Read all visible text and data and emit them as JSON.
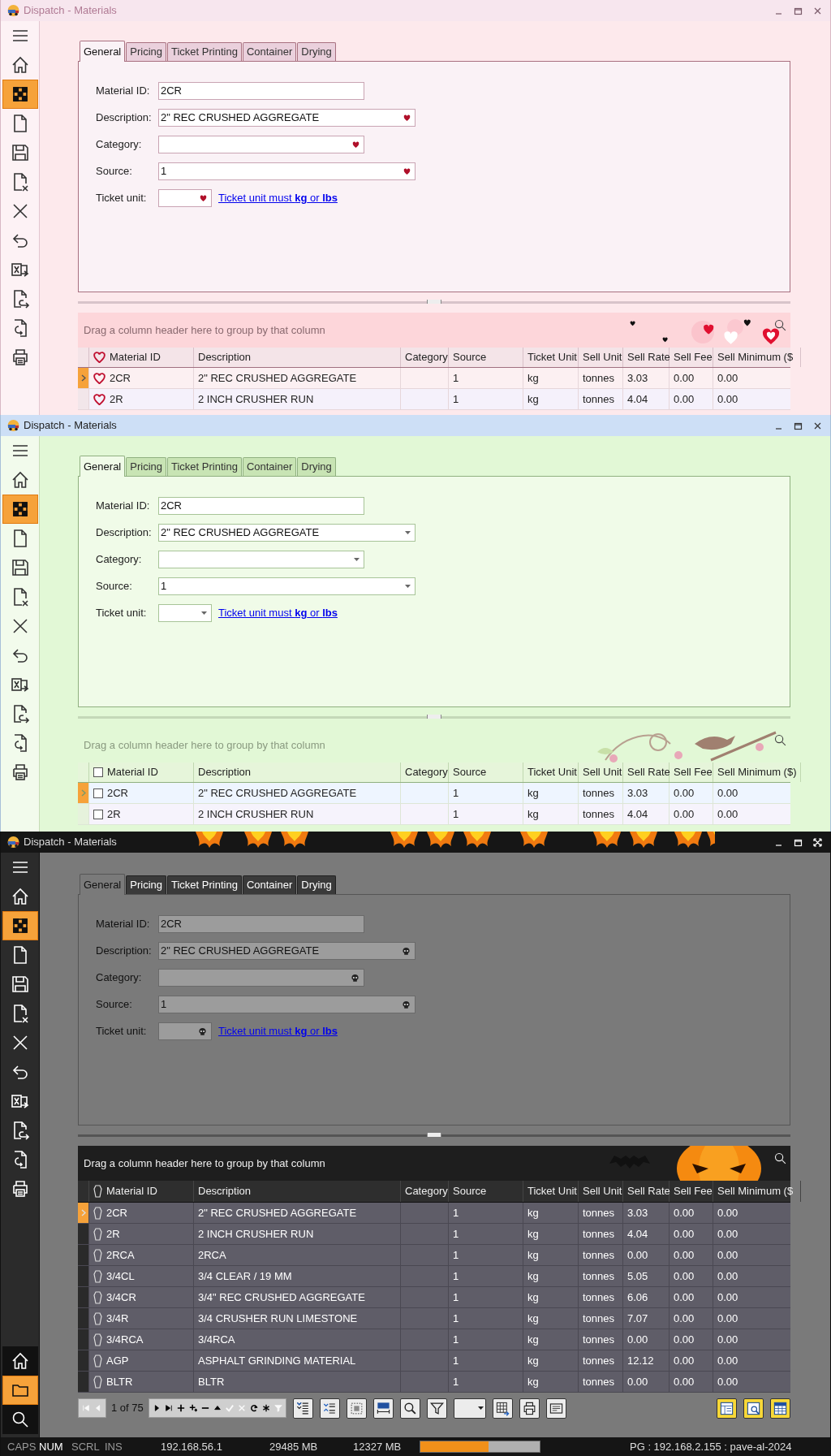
{
  "windows": [
    {
      "kind": "valentine",
      "title": "Dispatch - Materials",
      "title_buttons": [
        {
          "kind": "minimize"
        },
        {
          "kind": "maximize"
        },
        {
          "kind": "close"
        }
      ],
      "sidebar": [
        {
          "kind": "menu",
          "selected": false
        },
        {
          "kind": "home",
          "selected": false
        },
        {
          "kind": "grid",
          "selected": true
        },
        {
          "kind": "document",
          "selected": false
        },
        {
          "kind": "save",
          "selected": false
        },
        {
          "kind": "document-delete",
          "selected": false
        },
        {
          "kind": "close",
          "selected": false
        },
        {
          "kind": "undo",
          "selected": false
        },
        {
          "kind": "excel",
          "selected": false
        },
        {
          "kind": "document-import",
          "selected": false
        },
        {
          "kind": "document-export",
          "selected": false
        },
        {
          "kind": "print",
          "selected": false
        }
      ],
      "tabs": [
        {
          "label": "General",
          "selected": true
        },
        {
          "label": "Pricing",
          "selected": false
        },
        {
          "label": "Ticket Printing",
          "selected": false
        },
        {
          "label": "Container",
          "selected": false
        },
        {
          "label": "Drying",
          "selected": false
        }
      ],
      "form": [
        {
          "label": "Material ID:",
          "value": "2CR",
          "kind": "text"
        },
        {
          "label": "Description:",
          "value": "2\" REC CRUSHED AGGREGATE",
          "kind": "dropdown"
        },
        {
          "label": "Category:",
          "kind": "dropdown"
        },
        {
          "label": "Source:",
          "value": "1",
          "kind": "dropdown"
        },
        {
          "label": "Ticket unit:",
          "kind": "dropdown",
          "note": "Ticket unit must **kg** or **lbs**"
        }
      ],
      "grid": {
        "group_panel": "Drag a column header here to group by that column",
        "columns": [
          "Material ID",
          "Description",
          "Category",
          "Source",
          "Ticket Unit",
          "Sell Unit",
          "Sell Rate",
          "Sell Fee",
          "Sell Minimum ($"
        ],
        "rows": [
          {
            "current": true,
            "cells": [
              "2CR",
              "2\" REC CRUSHED AGGREGATE",
              "",
              "1",
              "kg",
              "tonnes",
              "3.03",
              "0.00",
              "0.00"
            ]
          },
          {
            "current": false,
            "cells": [
              "2R",
              "2 INCH CRUSHER RUN",
              "",
              "1",
              "kg",
              "tonnes",
              "4.04",
              "0.00",
              "0.00"
            ]
          }
        ]
      }
    },
    {
      "kind": "spring",
      "title": "Dispatch - Materials",
      "title_buttons": [
        {
          "kind": "minimize"
        },
        {
          "kind": "maximize"
        },
        {
          "kind": "close"
        }
      ],
      "sidebar": [
        {
          "kind": "menu",
          "selected": false
        },
        {
          "kind": "home",
          "selected": false
        },
        {
          "kind": "grid",
          "selected": true
        },
        {
          "kind": "document",
          "selected": false
        },
        {
          "kind": "save",
          "selected": false
        },
        {
          "kind": "document-delete",
          "selected": false
        },
        {
          "kind": "close",
          "selected": false
        },
        {
          "kind": "undo",
          "selected": false
        },
        {
          "kind": "excel",
          "selected": false
        },
        {
          "kind": "document-import",
          "selected": false
        },
        {
          "kind": "document-export",
          "selected": false
        },
        {
          "kind": "print",
          "selected": false
        }
      ],
      "tabs": [
        {
          "label": "General",
          "selected": true
        },
        {
          "label": "Pricing",
          "selected": false
        },
        {
          "label": "Ticket Printing",
          "selected": false
        },
        {
          "label": "Container",
          "selected": false
        },
        {
          "label": "Drying",
          "selected": false
        }
      ],
      "form": [
        {
          "label": "Material ID:",
          "value": "2CR",
          "kind": "text"
        },
        {
          "label": "Description:",
          "value": "2\" REC CRUSHED AGGREGATE",
          "kind": "dropdown"
        },
        {
          "label": "Category:",
          "kind": "dropdown"
        },
        {
          "label": "Source:",
          "value": "1",
          "kind": "dropdown"
        },
        {
          "label": "Ticket unit:",
          "kind": "dropdown",
          "note": "Ticket unit must **kg** or **lbs**"
        }
      ],
      "grid": {
        "group_panel": "Drag a column header here to group by that column",
        "header_checked": false,
        "columns": [
          "Material ID",
          "Description",
          "Category",
          "Source",
          "Ticket Unit",
          "Sell Unit",
          "Sell Rate",
          "Sell Fee",
          "Sell Minimum ($)"
        ],
        "rows": [
          {
            "current": true,
            "checked": false,
            "cells": [
              "2CR",
              "2\" REC CRUSHED AGGREGATE",
              "",
              "1",
              "kg",
              "tonnes",
              "3.03",
              "0.00",
              "0.00"
            ]
          },
          {
            "current": false,
            "checked": false,
            "cells": [
              "2R",
              "2 INCH CRUSHER RUN",
              "",
              "1",
              "kg",
              "tonnes",
              "4.04",
              "0.00",
              "0.00"
            ]
          }
        ]
      }
    },
    {
      "kind": "halloween",
      "title": "Dispatch - Materials",
      "title_buttons": [
        {
          "kind": "minimize"
        },
        {
          "kind": "maximize"
        },
        {
          "kind": "fullscreen"
        }
      ],
      "sidebar": [
        {
          "kind": "menu",
          "selected": false
        },
        {
          "kind": "home",
          "selected": false
        },
        {
          "kind": "grid",
          "selected": true
        },
        {
          "kind": "document",
          "selected": false
        },
        {
          "kind": "save",
          "selected": false
        },
        {
          "kind": "document-delete",
          "selected": false
        },
        {
          "kind": "close",
          "selected": false
        },
        {
          "kind": "undo",
          "selected": false
        },
        {
          "kind": "excel",
          "selected": false
        },
        {
          "kind": "document-import",
          "selected": false
        },
        {
          "kind": "document-export",
          "selected": false
        },
        {
          "kind": "print",
          "selected": false
        }
      ],
      "sidebar_bottom": [
        {
          "kind": "home",
          "selected": false
        },
        {
          "kind": "folder",
          "selected": true
        },
        {
          "kind": "search",
          "selected": false
        }
      ],
      "tabs": [
        {
          "label": "General",
          "selected": true
        },
        {
          "label": "Pricing",
          "selected": false
        },
        {
          "label": "Ticket Printing",
          "selected": false
        },
        {
          "label": "Container",
          "selected": false
        },
        {
          "label": "Drying",
          "selected": false
        }
      ],
      "form": [
        {
          "label": "Material ID:",
          "value": "2CR",
          "kind": "text"
        },
        {
          "label": "Description:",
          "value": "2\" REC CRUSHED AGGREGATE",
          "kind": "dropdown"
        },
        {
          "label": "Category:",
          "kind": "dropdown"
        },
        {
          "label": "Source:",
          "value": "1",
          "kind": "dropdown"
        },
        {
          "label": "Ticket unit:",
          "kind": "dropdown",
          "note": "Ticket unit must **kg** or **lbs**"
        }
      ],
      "grid": {
        "group_panel": "Drag a column header here to group by that column",
        "columns": [
          "Material ID",
          "Description",
          "Category",
          "Source",
          "Ticket Unit",
          "Sell Unit",
          "Sell Rate",
          "Sell Fee",
          "Sell Minimum ($"
        ],
        "rows": [
          {
            "current": true,
            "cells": [
              "2CR",
              "2\" REC CRUSHED AGGREGATE",
              "",
              "1",
              "kg",
              "tonnes",
              "3.03",
              "0.00",
              "0.00"
            ]
          },
          {
            "current": false,
            "cells": [
              "2R",
              "2 INCH CRUSHER RUN",
              "",
              "1",
              "kg",
              "tonnes",
              "4.04",
              "0.00",
              "0.00"
            ]
          },
          {
            "current": false,
            "cells": [
              "2RCA",
              "2RCA",
              "",
              "1",
              "kg",
              "tonnes",
              "0.00",
              "0.00",
              "0.00"
            ]
          },
          {
            "current": false,
            "cells": [
              "3/4CL",
              "3/4 CLEAR / 19 MM",
              "",
              "1",
              "kg",
              "tonnes",
              "5.05",
              "0.00",
              "0.00"
            ]
          },
          {
            "current": false,
            "cells": [
              "3/4CR",
              "3/4\" REC CRUSHED AGGREGATE",
              "",
              "1",
              "kg",
              "tonnes",
              "6.06",
              "0.00",
              "0.00"
            ]
          },
          {
            "current": false,
            "cells": [
              "3/4R",
              "3/4 CRUSHER RUN LIMESTONE",
              "",
              "1",
              "kg",
              "tonnes",
              "7.07",
              "0.00",
              "0.00"
            ]
          },
          {
            "current": false,
            "cells": [
              "3/4RCA",
              "3/4RCA",
              "",
              "1",
              "kg",
              "tonnes",
              "0.00",
              "0.00",
              "0.00"
            ]
          },
          {
            "current": false,
            "cells": [
              "AGP",
              "ASPHALT GRINDING MATERIAL",
              "",
              "1",
              "kg",
              "tonnes",
              "12.12",
              "0.00",
              "0.00"
            ]
          },
          {
            "current": false,
            "cells": [
              "BLTR",
              "BLTR",
              "",
              "1",
              "kg",
              "tonnes",
              "0.00",
              "0.00",
              "0.00"
            ]
          }
        ]
      },
      "pager": {
        "nav_before": [
          {
            "kind": "first",
            "disabled": true
          },
          {
            "kind": "prev",
            "disabled": true
          }
        ],
        "position": "1 of 75",
        "nav_after": [
          {
            "kind": "next",
            "disabled": false
          },
          {
            "kind": "last",
            "disabled": false
          },
          {
            "kind": "plus",
            "disabled": false
          },
          {
            "kind": "plus-child",
            "disabled": false
          },
          {
            "kind": "minus",
            "disabled": false
          },
          {
            "kind": "up",
            "disabled": false
          },
          {
            "kind": "check",
            "disabled": true
          },
          {
            "kind": "cross",
            "disabled": true
          },
          {
            "kind": "refresh",
            "disabled": false
          },
          {
            "kind": "asterisk",
            "disabled": false
          },
          {
            "kind": "filter",
            "disabled": true
          }
        ],
        "buttons": [
          {
            "kind": "expand-rows",
            "selected": false
          },
          {
            "kind": "collapse-rows",
            "selected": false
          },
          {
            "kind": "select-cells",
            "selected": false
          },
          {
            "kind": "auto-width",
            "selected": false
          },
          {
            "kind": "find",
            "selected": false
          },
          {
            "kind": "filter",
            "selected": false
          },
          {
            "kind": "dropdown",
            "selected": false
          },
          {
            "kind": "export-grid",
            "selected": false
          },
          {
            "kind": "print",
            "selected": false
          },
          {
            "kind": "card",
            "selected": false
          }
        ],
        "right_buttons": [
          {
            "kind": "layout",
            "selected": true
          },
          {
            "kind": "preview",
            "selected": true
          },
          {
            "kind": "table",
            "selected": true
          }
        ]
      },
      "status_bar": {
        "keys": [
          {
            "label": "CAPS",
            "on": false
          },
          {
            "label": "NUM",
            "on": true
          },
          {
            "label": "SCRL",
            "on": false
          },
          {
            "label": "INS",
            "on": false
          }
        ],
        "ip": "192.168.56.1",
        "memory_1": "29485 MB",
        "memory_2": "12327 MB",
        "memory_bar": {
          "level": 0.57
        },
        "connection": "PG : 192.168.2.155 : pave-al-2024"
      }
    }
  ]
}
